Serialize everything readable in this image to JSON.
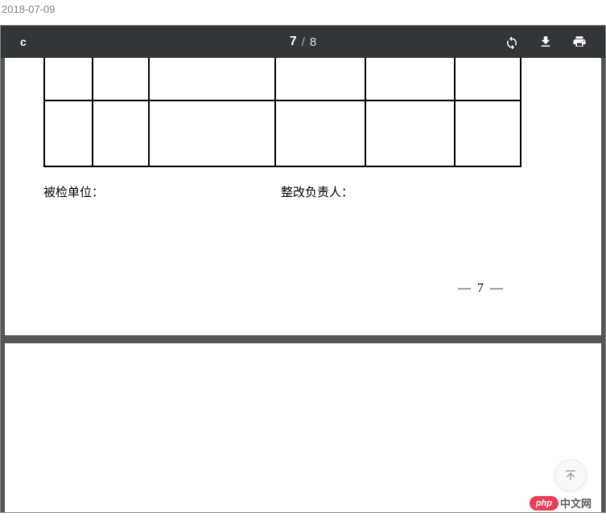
{
  "date": "2018-07-09",
  "toolbar": {
    "title": "c",
    "page_current": "7",
    "page_sep": "/",
    "page_total": "8"
  },
  "doc": {
    "label_left": "被检单位：",
    "label_right": "整改负责人：",
    "page_number_display": "— 7 —"
  },
  "watermark": {
    "badge": "php",
    "text": "中文网"
  },
  "icons": {
    "rotate": "rotate-icon",
    "download": "download-icon",
    "print": "print-icon",
    "scroll_top": "scroll-top-icon"
  }
}
